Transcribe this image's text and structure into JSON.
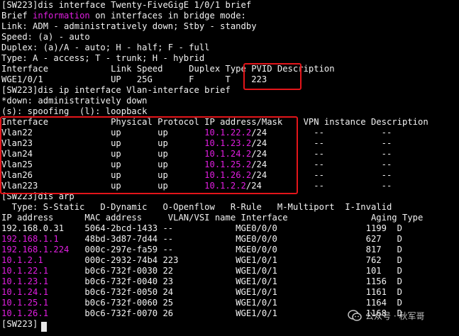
{
  "terminal": {
    "text_color": "#f2f2f2",
    "highlight_color": "#e01ee0",
    "annotation_box_color": "#e3151a",
    "lines": [
      [
        {
          "t": "[SW223]dis interface Twenty-FiveGigE 1/0/1 brief"
        }
      ],
      [
        {
          "t": "Brief "
        },
        {
          "t": "information",
          "c": "#e01ee0"
        },
        {
          "t": " on interfaces in bridge mode:"
        }
      ],
      [
        {
          "t": "Link: ADM - administratively down; Stby - standby"
        }
      ],
      [
        {
          "t": "Speed: (a) - auto"
        }
      ],
      [
        {
          "t": "Duplex: (a)/A - auto; H - half; F - full"
        }
      ],
      [
        {
          "t": "Type: A - access; T - trunk; H - hybrid"
        }
      ],
      [
        {
          "t": "Interface            Link Speed     Duplex Type PVID Description"
        }
      ],
      [
        {
          "t": "WGE1/0/1             UP   25G       F      T    223"
        }
      ],
      [
        {
          "t": "[SW223]dis ip interface Vlan-interface brief"
        }
      ],
      [
        {
          "t": "*down: administratively down"
        }
      ],
      [
        {
          "t": "(s): spoofing  (l): loopback"
        }
      ],
      [
        {
          "t": "Interface            Physical Protocol IP address/Mask    VPN instance Description"
        }
      ],
      [
        {
          "t": "Vlan22               up       up       "
        },
        {
          "t": "10.1.22.2",
          "c": "#e01ee0"
        },
        {
          "t": "/24         --           --"
        }
      ],
      [
        {
          "t": "Vlan23               up       up       "
        },
        {
          "t": "10.1.23.2",
          "c": "#e01ee0"
        },
        {
          "t": "/24         --           --"
        }
      ],
      [
        {
          "t": "Vlan24               up       up       "
        },
        {
          "t": "10.1.24.2",
          "c": "#e01ee0"
        },
        {
          "t": "/24         --           --"
        }
      ],
      [
        {
          "t": "Vlan25               up       up       "
        },
        {
          "t": "10.1.25.2",
          "c": "#e01ee0"
        },
        {
          "t": "/24         --           --"
        }
      ],
      [
        {
          "t": "Vlan26               up       up       "
        },
        {
          "t": "10.1.26.2",
          "c": "#e01ee0"
        },
        {
          "t": "/24         --           --"
        }
      ],
      [
        {
          "t": "Vlan223              up       up       "
        },
        {
          "t": "10.1.2.2",
          "c": "#e01ee0"
        },
        {
          "t": "/24          --           --"
        }
      ],
      [
        {
          "t": "[SW223]dis arp"
        }
      ],
      [
        {
          "t": "  Type: S-Static   D-Dynamic   O-Openflow   R-Rule   M-Multiport  I-Invalid"
        }
      ],
      [
        {
          "t": "IP address      MAC address     VLAN/VSI name Interface                Aging Type"
        }
      ],
      [
        {
          "t": "192.168.0.31    5064-2bcd-1433 --            MGE0/0/0                 1199  D"
        }
      ],
      [
        {
          "t": "192.168.1.1",
          "c": "#e01ee0"
        },
        {
          "t": "     48bd-3d87-7d44 --            MGE0/0/0                 627   D"
        }
      ],
      [
        {
          "t": "192.168.1.224",
          "c": "#e01ee0"
        },
        {
          "t": "   000c-297e-fa59 --            MGE0/0/0                 817   D"
        }
      ],
      [
        {
          "t": "10.1.2.1",
          "c": "#e01ee0"
        },
        {
          "t": "        000c-2932-74b4 223           WGE1/0/1                 762   D"
        }
      ],
      [
        {
          "t": "10.1.22.1",
          "c": "#e01ee0"
        },
        {
          "t": "       b0c6-732f-0030 22            WGE1/0/1                 101   D"
        }
      ],
      [
        {
          "t": "10.1.23.1",
          "c": "#e01ee0"
        },
        {
          "t": "       b0c6-732f-0040 23            WGE1/0/1                 1156  D"
        }
      ],
      [
        {
          "t": "10.1.24.1",
          "c": "#e01ee0"
        },
        {
          "t": "       b0c6-732f-0050 24            WGE1/0/1                 1161  D"
        }
      ],
      [
        {
          "t": "10.1.25.1",
          "c": "#e01ee0"
        },
        {
          "t": "       b0c6-732f-0060 25            WGE1/0/1                 1164  D"
        }
      ],
      [
        {
          "t": "10.1.26.1",
          "c": "#e01ee0"
        },
        {
          "t": "       b0c6-732f-0070 26            WGE1/0/1                 1168  D"
        }
      ],
      [
        {
          "t": "[SW223]"
        }
      ]
    ]
  },
  "watermark": {
    "icon": "wechat-official-account-icon",
    "text": "公众号 · 秋军哥"
  }
}
